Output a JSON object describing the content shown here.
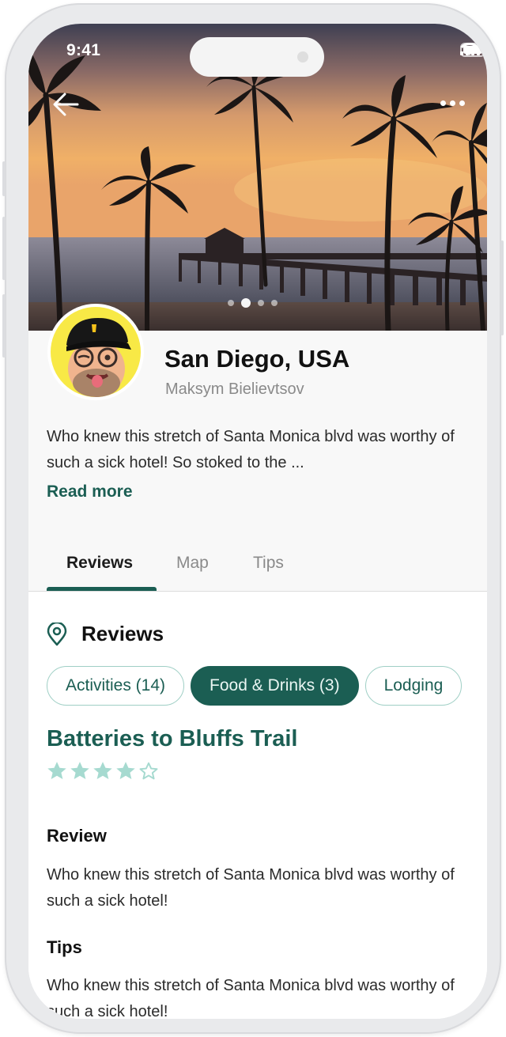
{
  "status_bar": {
    "time": "9:41"
  },
  "hero": {
    "image": "sunset-pier-palms",
    "slide_count": 4,
    "active_slide": 2
  },
  "profile": {
    "title": "San Diego, USA",
    "author": "Maksym Bielievtsov",
    "description": "Who knew this stretch of Santa Monica blvd was worthy of such a sick hotel! So stoked to the ...",
    "read_more": "Read more"
  },
  "tabs": [
    {
      "label": "Reviews",
      "active": true
    },
    {
      "label": "Map",
      "active": false
    },
    {
      "label": "Tips",
      "active": false
    }
  ],
  "reviews": {
    "title": "Reviews",
    "chips": [
      {
        "label": "Activities (14)",
        "active": false
      },
      {
        "label": "Food & Drinks (3)",
        "active": true
      },
      {
        "label": "Lodging",
        "active": false
      }
    ],
    "trail_title": "Batteries to Bluffs Trail",
    "rating": 4,
    "rating_max": 5,
    "review_heading": "Review",
    "review_text": "Who knew this stretch of Santa Monica blvd was worthy of such a sick hotel!",
    "tips_heading": "Tips",
    "tips_text": "Who knew this stretch of Santa Monica blvd was worthy of such a sick hotel!"
  },
  "colors": {
    "brand": "#1b5e53",
    "chip_border": "#9fcfc5",
    "star": "#a6dad0"
  }
}
